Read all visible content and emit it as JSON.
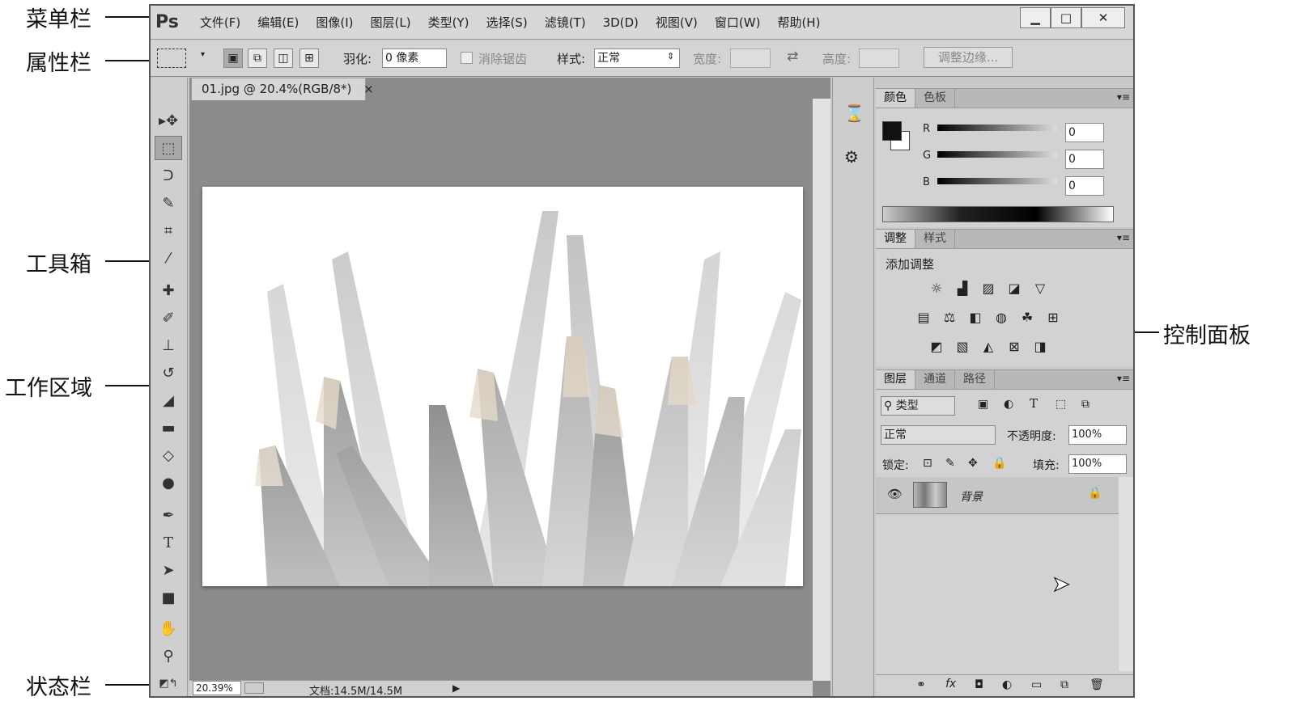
{
  "annotations": {
    "menubar": "菜单栏",
    "optionsbar": "属性栏",
    "toolbox": "工具箱",
    "workarea": "工作区域",
    "statusbar": "状态栏",
    "panels": "控制面板"
  },
  "app": {
    "logo": "Ps"
  },
  "menu": [
    "文件(F)",
    "编辑(E)",
    "图像(I)",
    "图层(L)",
    "类型(Y)",
    "选择(S)",
    "滤镜(T)",
    "3D(D)",
    "视图(V)",
    "窗口(W)",
    "帮助(H)"
  ],
  "window_controls": {
    "minimize": "▁",
    "maximize": "□",
    "close": "✕"
  },
  "options": {
    "feather_label": "羽化:",
    "feather_value": "0 像素",
    "antialias_label": "消除锯齿",
    "style_label": "样式:",
    "style_value": "正常",
    "width_label": "宽度:",
    "height_label": "高度:",
    "refine_edge": "调整边缘..."
  },
  "document": {
    "tab_title": "01.jpg @ 20.4%(RGB/8*)",
    "tab_close": "×",
    "zoom": "20.39%",
    "doc_info": "文档:14.5M/14.5M"
  },
  "color_panel": {
    "tabs": [
      "颜色",
      "色板"
    ],
    "channels": [
      {
        "label": "R",
        "value": "0"
      },
      {
        "label": "G",
        "value": "0"
      },
      {
        "label": "B",
        "value": "0"
      }
    ]
  },
  "adjustments_panel": {
    "tabs": [
      "调整",
      "样式"
    ],
    "heading": "添加调整"
  },
  "layers_panel": {
    "tabs": [
      "图层",
      "通道",
      "路径"
    ],
    "filter_kind": "类型",
    "blend_mode": "正常",
    "opacity_label": "不透明度:",
    "opacity_value": "100%",
    "lock_label": "锁定:",
    "fill_label": "填充:",
    "fill_value": "100%",
    "layers": [
      {
        "name": "背景",
        "visible": true,
        "locked": true
      }
    ]
  },
  "colors": {
    "chrome": "#d4d4d4",
    "canvas_bg": "#8b8b8b",
    "panel": "#d2d2d2"
  }
}
